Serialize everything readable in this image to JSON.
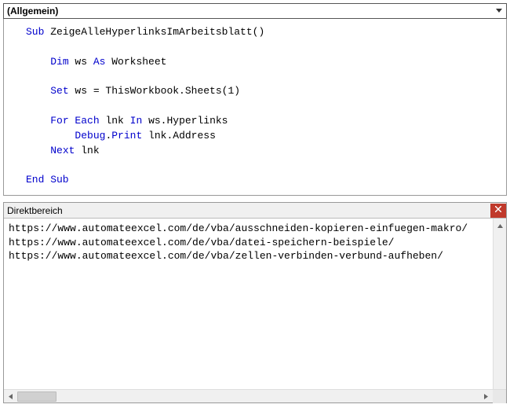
{
  "dropdown": {
    "selected": "(Allgemein)"
  },
  "code": {
    "line1_pre": "Sub",
    "line1_name": " ZeigeAlleHyperlinksImArbeitsblatt()",
    "line2_kw": "Dim",
    "line2_mid": " ws ",
    "line2_kw2": "As",
    "line2_end": " Worksheet",
    "line3_kw": "Set",
    "line3_end": " ws = ThisWorkbook.Sheets(1)",
    "line4_kw": "For Each",
    "line4_mid": " lnk ",
    "line4_kw2": "In",
    "line4_end": " ws.Hyperlinks",
    "line5_kw": "Debug",
    "line5_mid": ".",
    "line5_kw2": "Print",
    "line5_end": " lnk.Address",
    "line6_kw": "Next",
    "line6_end": " lnk",
    "line7_kw": "End Sub"
  },
  "immediate": {
    "title": "Direktbereich",
    "lines": [
      "https://www.automateexcel.com/de/vba/ausschneiden-kopieren-einfuegen-makro/",
      "https://www.automateexcel.com/de/vba/datei-speichern-beispiele/",
      "https://www.automateexcel.com/de/vba/zellen-verbinden-verbund-aufheben/"
    ]
  }
}
